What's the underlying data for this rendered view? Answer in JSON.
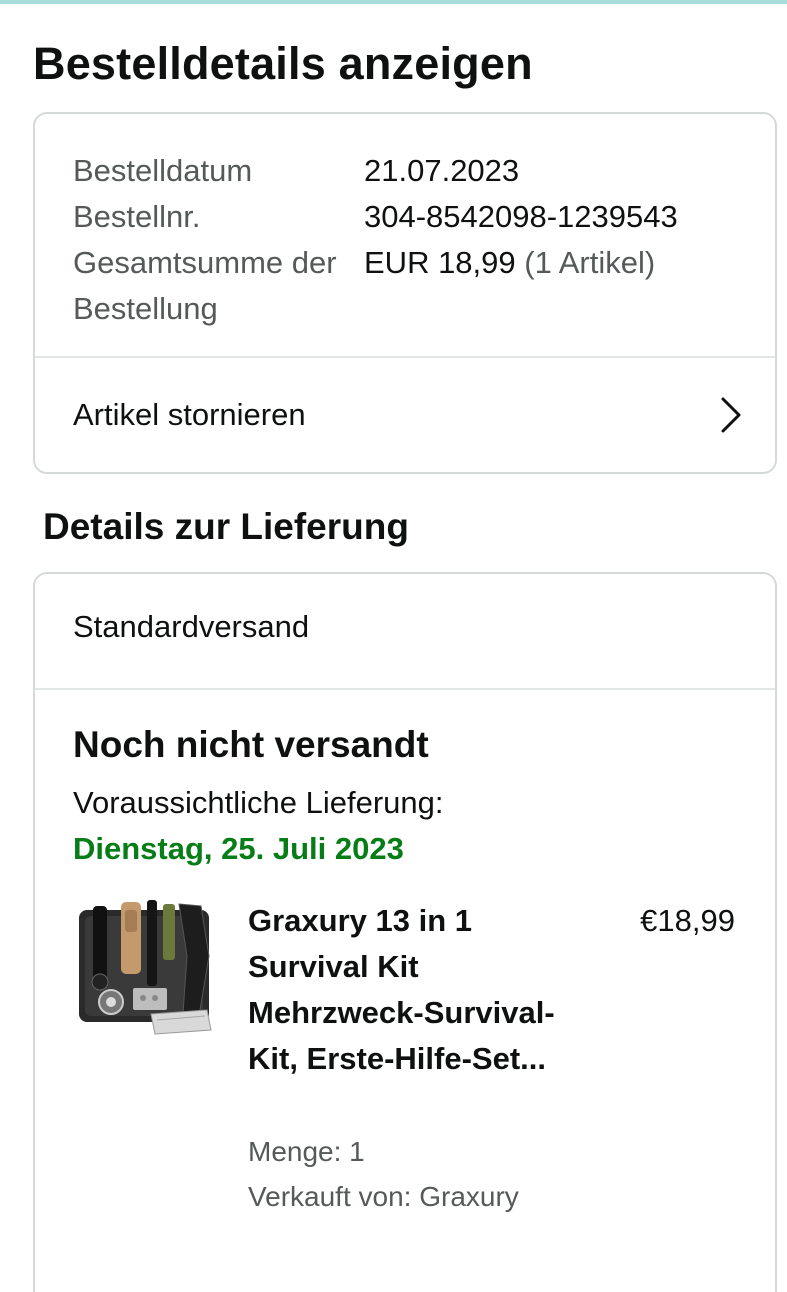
{
  "page": {
    "title": "Bestelldetails anzeigen"
  },
  "order": {
    "rows": [
      {
        "label": "Bestelldatum",
        "value": "21.07.2023"
      },
      {
        "label": "Bestellnr.",
        "value": "304-8542098-1239543"
      },
      {
        "label": "Gesamtsumme der Bestellung",
        "value": "EUR 18,99",
        "value_extra": "(1 Artikel)"
      }
    ],
    "cancel_label": "Artikel stornieren"
  },
  "delivery": {
    "section_title": "Details zur Lieferung",
    "shipping_method": "Standardversand",
    "status": "Noch nicht versandt",
    "eta_label": "Voraussichtliche Lieferung:",
    "eta_date": "Dienstag, 25. Juli 2023",
    "eta_color": "#067d17",
    "item": {
      "title": "Graxury 13 in 1 Survival Kit Mehrzweck-Survival-Kit, Erste-Hilfe-Set...",
      "price": "€18,99",
      "quantity": "Menge: 1",
      "seller": "Verkauft von: Graxury",
      "image_icon": "survival-kit-product-image"
    }
  },
  "colors": {
    "accent_top": "#a8ddd9",
    "border": "#d5d9d9",
    "muted_text": "#565959"
  }
}
